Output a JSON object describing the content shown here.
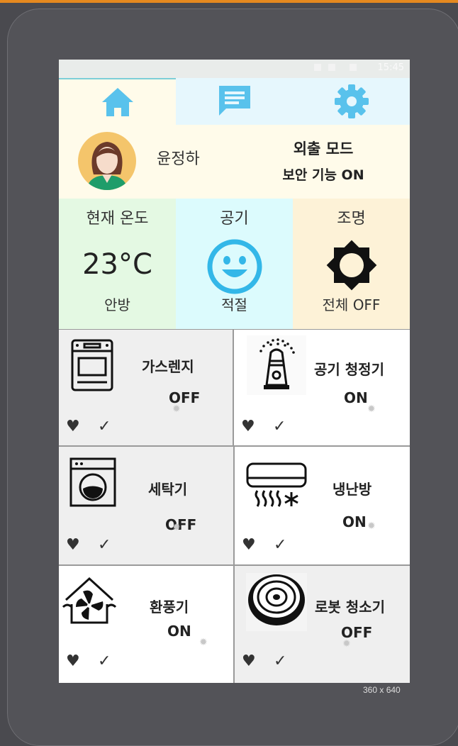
{
  "status": {
    "time": "15:45"
  },
  "tabs": [
    "home",
    "chat",
    "settings"
  ],
  "profile": {
    "name": "윤정하",
    "mode": "외출 모드",
    "security": "보안 기능 ON"
  },
  "tiles": {
    "temperature": {
      "title": "현재 온도",
      "value": "23°C",
      "room": "안방"
    },
    "air": {
      "title": "공기",
      "state": "적절"
    },
    "light": {
      "title": "조명",
      "state": "전체 OFF"
    }
  },
  "devices": [
    {
      "name": "가스렌지",
      "state": "OFF",
      "icon": "gas-stove-icon"
    },
    {
      "name": "공기 청정기",
      "state": "ON",
      "icon": "air-purifier-icon"
    },
    {
      "name": "세탁기",
      "state": "OFF",
      "icon": "washing-machine-icon"
    },
    {
      "name": "냉난방",
      "state": "ON",
      "icon": "air-conditioner-icon"
    },
    {
      "name": "환풍기",
      "state": "ON",
      "icon": "ventilation-fan-icon"
    },
    {
      "name": "로봇 청소기",
      "state": "OFF",
      "icon": "robot-vacuum-icon"
    }
  ],
  "symbols": {
    "heart": "♥",
    "check": "✓",
    "gear": "✹"
  },
  "resolution": "360 x 640",
  "colors": {
    "accent": "#e5891f",
    "icon_blue": "#59c2ec",
    "face_blue": "#33b7e8"
  }
}
